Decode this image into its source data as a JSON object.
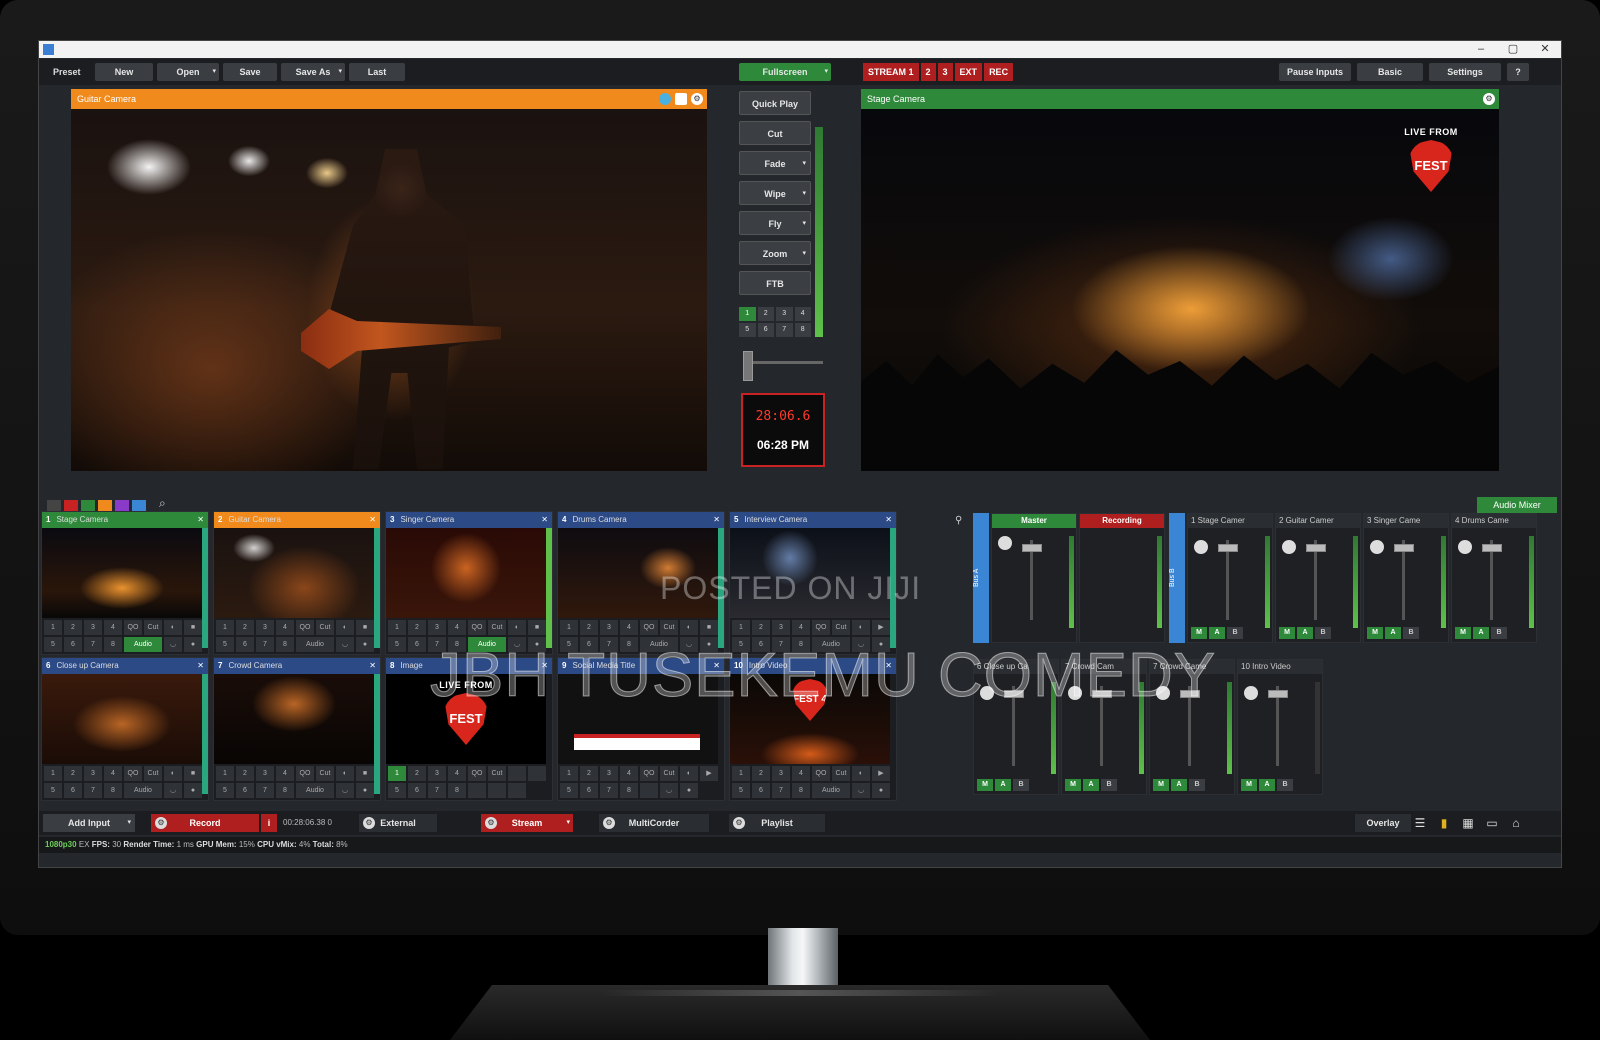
{
  "toolbar": {
    "preset": "Preset",
    "new": "New",
    "open": "Open",
    "save": "Save",
    "save_as": "Save As",
    "last": "Last",
    "fullscreen": "Fullscreen",
    "streams": [
      "STREAM 1",
      "2",
      "3",
      "EXT",
      "REC"
    ],
    "pause_inputs": "Pause Inputs",
    "basic": "Basic",
    "settings": "Settings",
    "help": "?"
  },
  "preview": {
    "title": "Guitar Camera"
  },
  "output": {
    "title": "Stage Camera",
    "overlay_live": "LIVE FROM",
    "overlay_fest": "FEST 4"
  },
  "transitions": {
    "quick_play": "Quick Play",
    "cut": "Cut",
    "fade": "Fade",
    "wipe": "Wipe",
    "fly": "Fly",
    "zoom": "Zoom",
    "ftb": "FTB",
    "grid": [
      "1",
      "2",
      "3",
      "4",
      "5",
      "6",
      "7",
      "8"
    ],
    "elapsed": "28:06.6",
    "clock": "06:28 PM"
  },
  "inputs": [
    {
      "num": "1",
      "name": "Stage Camera",
      "color": "#2e8a3a"
    },
    {
      "num": "2",
      "name": "Guitar Camera",
      "color": "#f08a1c"
    },
    {
      "num": "3",
      "name": "Singer Camera",
      "color": "#2c4a86"
    },
    {
      "num": "4",
      "name": "Drums Camera",
      "color": "#2c4a86"
    },
    {
      "num": "5",
      "name": "Interview Camera",
      "color": "#2c4a86"
    },
    {
      "num": "6",
      "name": "Close up Camera",
      "color": "#2c4a86"
    },
    {
      "num": "7",
      "name": "Crowd Camera",
      "color": "#2c4a86"
    },
    {
      "num": "8",
      "name": "Image",
      "color": "#2c4a86"
    },
    {
      "num": "9",
      "name": "Social Media Title",
      "color": "#2c4a86"
    },
    {
      "num": "10",
      "name": "Intro Video",
      "color": "#2c4a86"
    }
  ],
  "input_controls": {
    "row1": [
      "1",
      "2",
      "3",
      "4",
      "QO",
      "Cut"
    ],
    "row2": [
      "5",
      "6",
      "7",
      "8"
    ],
    "audio": "Audio"
  },
  "mixer": {
    "title": "Audio Mixer",
    "master": "Master",
    "recording": "Recording",
    "tab_a": "Bus A",
    "tab_b": "Bus B",
    "channels": [
      "1 Stage Camer",
      "2 Guitar Camer",
      "3 Singer Came",
      "4 Drums Came",
      "6 Close up Ca",
      "7 Crowd Cam",
      "7 Crowd Came",
      "10 Intro Video"
    ],
    "m": "M",
    "a": "A",
    "b": "B"
  },
  "bottombar": {
    "add_input": "Add Input",
    "record": "Record",
    "record_time": "00:28:06.38 0",
    "external": "External",
    "stream": "Stream",
    "multicorder": "MultiCorder",
    "playlist": "Playlist",
    "overlay": "Overlay"
  },
  "statusbar": {
    "res": "1080p30",
    "ex": "EX",
    "fps_label": "FPS:",
    "fps": "30",
    "render_label": "Render Time:",
    "render": "1 ms",
    "gpu_label": "GPU Mem:",
    "gpu": "15%",
    "cpu_label": "CPU vMix:",
    "cpu": "4%",
    "total_label": "Total:",
    "total": "8%"
  },
  "watermark": {
    "posted": "POSTED ON JIJI",
    "brand": "JBH TUSEKEMU COMEDY"
  },
  "colors": {
    "accent_green": "#2e8a3a",
    "accent_orange": "#f08a1c",
    "record_red": "#b01f1f",
    "blue": "#2c4a86"
  }
}
